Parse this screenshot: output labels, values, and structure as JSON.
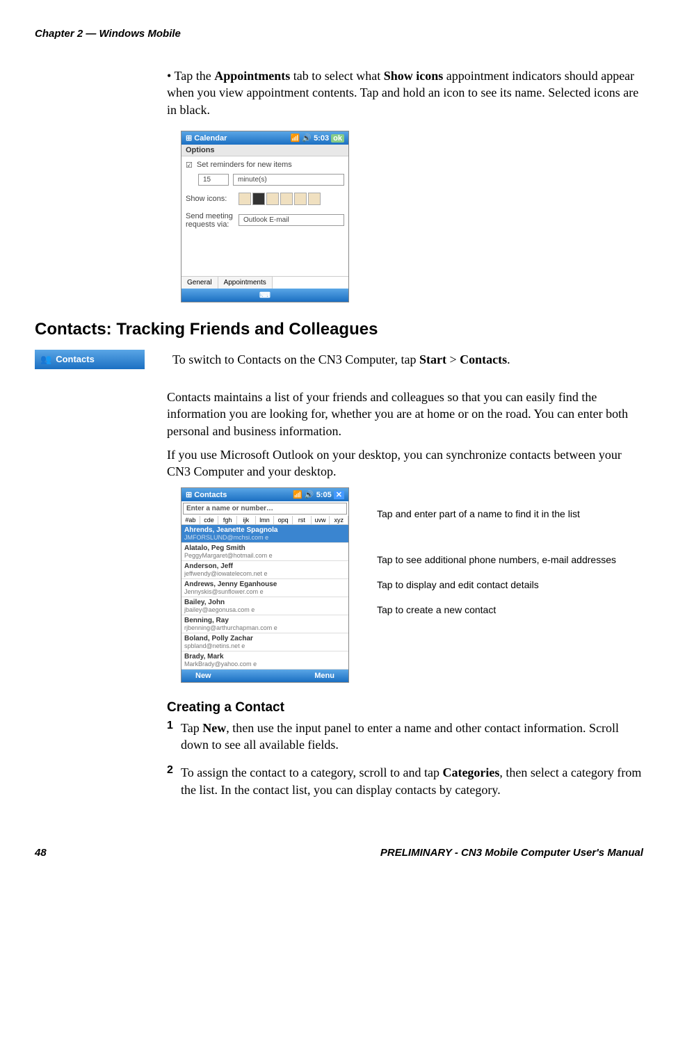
{
  "header": {
    "chapter": "Chapter 2 — Windows Mobile"
  },
  "bullet1": {
    "prefix": "• ",
    "text_p1": "Tap the ",
    "text_b1": "Appointments",
    "text_p2": " tab to select what ",
    "text_b2": "Show icons",
    "text_p3": " appointment indicators should appear when you view appointment contents. Tap and hold an icon to see its name. Selected icons are in black."
  },
  "wm_cal": {
    "title": "Calendar",
    "time": "5:03",
    "ok": "ok",
    "options": "Options",
    "reminders": "Set reminders for new items",
    "num": "15",
    "unit": "minute(s)",
    "showicons": "Show icons:",
    "sendvia": "Send meeting requests via:",
    "outlook": "Outlook E-mail",
    "tab1": "General",
    "tab2": "Appointments"
  },
  "section_title": "Contacts: Tracking Friends and Colleagues",
  "badge": {
    "label": "Contacts"
  },
  "switch_line": {
    "p1": "To switch to Contacts on the CN3 Computer, tap ",
    "b1": "Start",
    "p2": " > ",
    "b2": "Contacts",
    "p3": "."
  },
  "para1": "Contacts maintains a list of your friends and colleagues so that you can easily find the information you are looking for, whether you are at home or on the road. You can enter both personal and business information.",
  "para2": "If you use Microsoft Outlook on your desktop, you can synchronize contacts between your CN3 Computer and your desktop.",
  "wm_contacts": {
    "title": "Contacts",
    "time": "5:05",
    "search": "Enter a name or number…",
    "filters": [
      "#ab",
      "cde",
      "fgh",
      "ijk",
      "lmn",
      "opq",
      "rst",
      "uvw",
      "xyz"
    ],
    "items": [
      {
        "name": "Ahrends, Jeanette Spagnola",
        "email": "JMFORSLUND@mchsi.com  e"
      },
      {
        "name": "Alatalo, Peg Smith",
        "email": "PeggyMargaret@hotmail.com  e"
      },
      {
        "name": "Anderson, Jeff",
        "email": "jeffwendy@iowatelecom.net  e"
      },
      {
        "name": "Andrews, Jenny Eganhouse",
        "email": "Jennyskis@sunflower.com  e"
      },
      {
        "name": "Bailey, John",
        "email": "jbailey@aegonusa.com  e"
      },
      {
        "name": "Benning, Ray",
        "email": "rjbenning@arthurchapman.com  e"
      },
      {
        "name": "Boland, Polly Zachar",
        "email": "spbland@netins.net  e"
      },
      {
        "name": "Brady, Mark",
        "email": "MarkBrady@yahoo.com  e"
      }
    ],
    "sk_left": "New",
    "sk_right": "Menu"
  },
  "annot": {
    "a1": "Tap and enter part of a name to find it in the list",
    "a2": "Tap to see additional phone numbers, e-mail addresses",
    "a3": "Tap to display and edit contact details",
    "a4": "Tap to create a new contact"
  },
  "subsection": "Creating a Contact",
  "step1": {
    "num": "1",
    "p1": "Tap ",
    "b1": "New",
    "p2": ", then use the input panel to enter a name and other contact information. Scroll down to see all available fields."
  },
  "step2": {
    "num": "2",
    "p1": "To assign the contact to a category, scroll to and tap ",
    "b1": "Categories",
    "p2": ", then select a category from the list. In the contact list, you can display contacts by category."
  },
  "footer": {
    "page": "48",
    "title": "PRELIMINARY - CN3 Mobile Computer User's Manual"
  }
}
